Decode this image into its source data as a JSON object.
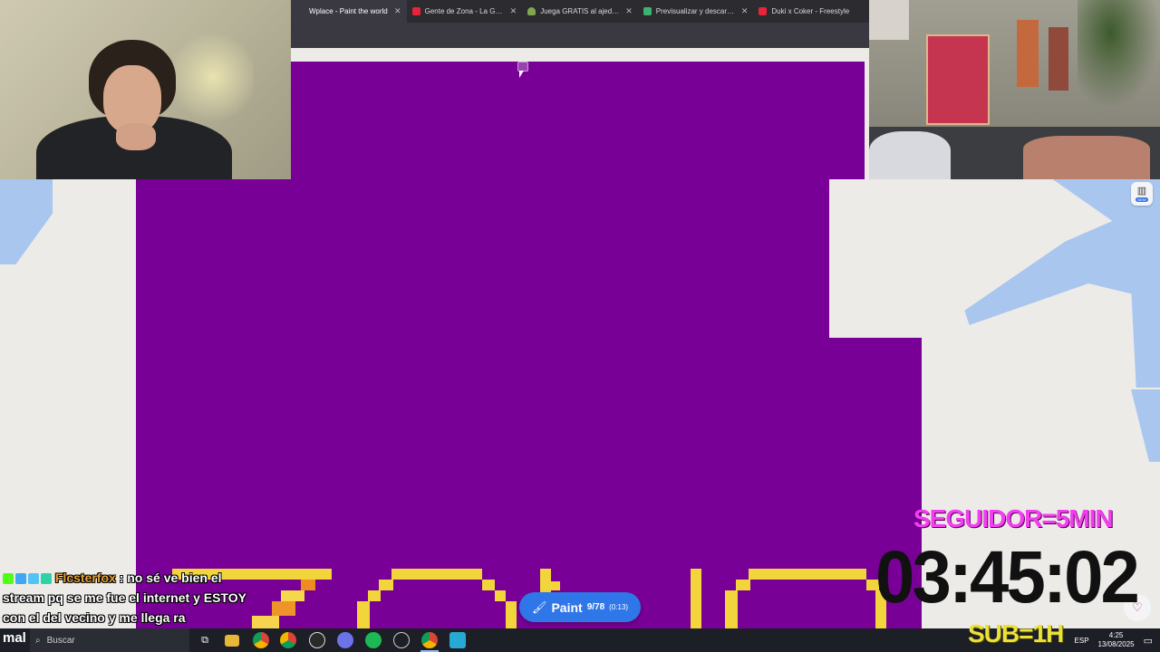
{
  "browser": {
    "tabs": [
      {
        "title": "Wplace - Paint the world",
        "active": true,
        "favicon_color": "#3a3840"
      },
      {
        "title": "Gente de Zona - La Gozadera",
        "active": false,
        "favicon_color": "#e8233a"
      },
      {
        "title": "Juega GRATIS al ajedrez online",
        "active": false,
        "favicon_color": "#7fa650"
      },
      {
        "title": "Previsualizar y descargar imagen",
        "active": false,
        "favicon_color": "#3cb371"
      },
      {
        "title": "Duki x Coker - Freestyle",
        "active": false,
        "favicon_color": "#e8233a"
      }
    ]
  },
  "wplace": {
    "paint_button": {
      "label": "Paint",
      "count": "9/78",
      "timer": "(0:13)"
    },
    "side_button_badge": "NEW",
    "colors": {
      "purple": "#780096",
      "yellow": "#f2d53b",
      "water": "#a9c6ef",
      "land": "#ecebe7",
      "accent": "#2f76e8"
    }
  },
  "chat": {
    "username": "Flcsterfox",
    "message": ": no sé ve bien el stream pq se me fue el internet y ESTOY con el del vecino y me llega ra",
    "partial": "mal"
  },
  "overlay": {
    "seguidor": "SEGUIDOR=5MIN",
    "timer": "03:45:02",
    "sub": "SUB=1H"
  },
  "taskbar": {
    "search_placeholder": "Buscar",
    "language": "ESP",
    "time": "4:25",
    "date": "13/08/2025"
  }
}
